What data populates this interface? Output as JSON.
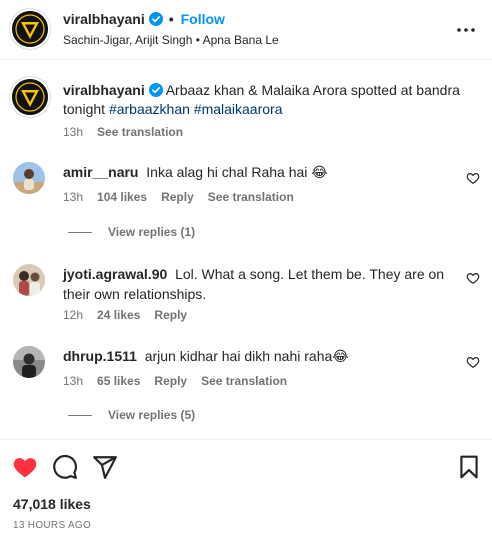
{
  "header": {
    "username": "viralbhayani",
    "separator": "•",
    "follow_label": "Follow",
    "audio": "Sachin-Jigar, Arijit Singh • Apna Bana Le"
  },
  "caption": {
    "username": "viralbhayani",
    "text": "Arbaaz khan & Malaika Arora spotted at bandra tonight",
    "hashtags": "#arbaazkhan #malaikaarora",
    "time": "13h",
    "see_translation": "See translation"
  },
  "comments": [
    {
      "username": "amir__naru",
      "text": "Inka alag hi chal Raha hai 😂",
      "time": "13h",
      "likes": "104 likes",
      "reply": "Reply",
      "see_translation": "See translation",
      "view_replies": "View replies (1)"
    },
    {
      "username": "jyoti.agrawal.90",
      "text": "Lol. What a song. Let them be. They are on their own relationships.",
      "time": "12h",
      "likes": "24 likes",
      "reply": "Reply"
    },
    {
      "username": "dhrup.1511",
      "text": "arjun kidhar hai dikh nahi raha😂",
      "time": "13h",
      "likes": "65 likes",
      "reply": "Reply",
      "see_translation": "See translation",
      "view_replies": "View replies (5)"
    }
  ],
  "post": {
    "likes": "47,018 likes",
    "timestamp": "13 HOURS AGO",
    "liked": true
  },
  "colors": {
    "accent_blue": "#0095f6",
    "like_red": "#ff3040",
    "verified_blue": "#0095f6",
    "brand_yellow": "#f5c400",
    "hashtag": "#00376b"
  },
  "icons": {
    "more": "more-horizontal-icon",
    "like": "heart-filled-icon",
    "comment": "comment-bubble-icon",
    "share": "paper-plane-icon",
    "save": "bookmark-icon"
  }
}
